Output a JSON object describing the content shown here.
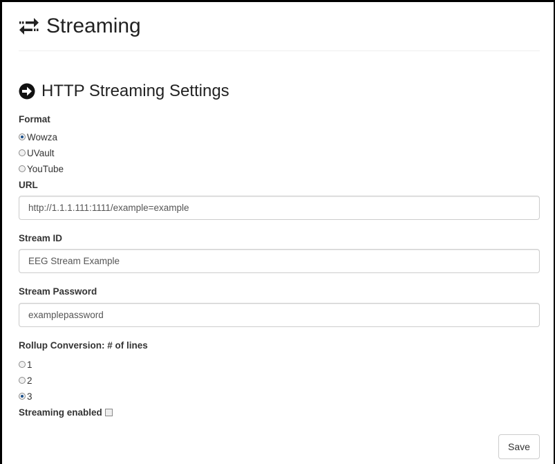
{
  "header": {
    "title": "Streaming",
    "icon": "exchange-arrows-icon"
  },
  "section": {
    "title": "HTTP Streaming Settings",
    "icon": "circle-arrow-right-icon"
  },
  "format": {
    "label": "Format",
    "options": [
      {
        "label": "Wowza",
        "checked": true
      },
      {
        "label": "UVault",
        "checked": false
      },
      {
        "label": "YouTube",
        "checked": false
      }
    ]
  },
  "url": {
    "label": "URL",
    "value": "http://1.1.1.111:1111/example=example"
  },
  "stream_id": {
    "label": "Stream ID",
    "value": "EEG Stream Example"
  },
  "stream_password": {
    "label": "Stream Password",
    "value": "examplepassword"
  },
  "rollup": {
    "label": "Rollup Conversion: # of lines",
    "options": [
      {
        "label": "1",
        "checked": false
      },
      {
        "label": "2",
        "checked": false
      },
      {
        "label": "3",
        "checked": true
      }
    ]
  },
  "streaming_enabled": {
    "label": "Streaming enabled",
    "checked": false
  },
  "save_label": "Save",
  "colors": {
    "accent_radio": "#1a4f8b",
    "border": "#cccccc",
    "text": "#333333"
  }
}
